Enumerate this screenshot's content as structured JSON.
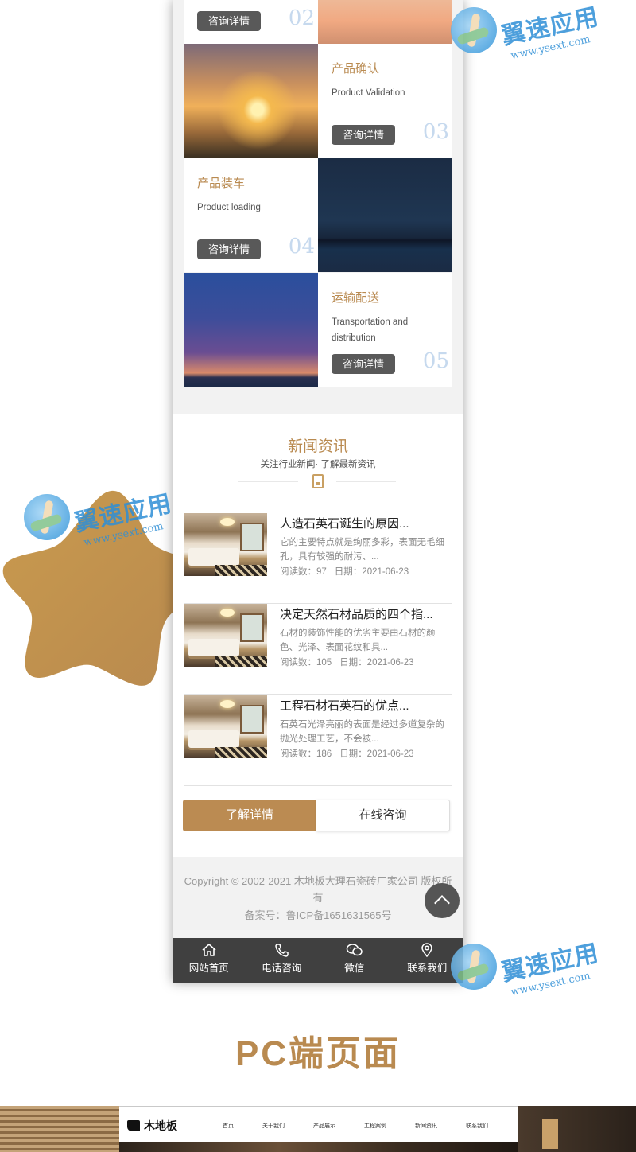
{
  "process": {
    "steps": [
      {
        "title": "",
        "subtitle": "",
        "button": "咨询详情",
        "number": "02"
      },
      {
        "title": "产品确认",
        "subtitle": "Product Validation",
        "button": "咨询详情",
        "number": "03"
      },
      {
        "title": "产品装车",
        "subtitle": "Product loading",
        "button": "咨询详情",
        "number": "04"
      },
      {
        "title": "运输配送",
        "subtitle": "Transportation and distribution",
        "button": "咨询详情",
        "number": "05"
      }
    ]
  },
  "news": {
    "title": "新闻资讯",
    "subtitle": "关注行业新闻· 了解最新资讯",
    "items": [
      {
        "title": "人造石英石诞生的原因...",
        "desc": "它的主要特点就是绚丽多彩，表面无毛细孔，具有较强的耐污、...",
        "reads_label": "阅读数：97",
        "date_label": "日期：2021-06-23"
      },
      {
        "title": "决定天然石材品质的四个指...",
        "desc": "石材的装饰性能的优劣主要由石材的颜色、光泽、表面花纹和具...",
        "reads_label": "阅读数：105",
        "date_label": "日期：2021-06-23"
      },
      {
        "title": "工程石材石英石的优点...",
        "desc": "石英石光泽亮丽的表面是经过多道复杂的抛光处理工艺，不会被...",
        "reads_label": "阅读数：186",
        "date_label": "日期：2021-06-23"
      }
    ],
    "buttons": {
      "primary": "了解详情",
      "secondary": "在线咨询"
    }
  },
  "footer": {
    "copyright": "Copyright © 2002-2021 木地板大理石瓷砖厂家公司 版权所有",
    "icp": "备案号：鲁ICP备1651631565号"
  },
  "tabbar": [
    {
      "label": "网站首页",
      "icon": "home-icon"
    },
    {
      "label": "电话咨询",
      "icon": "phone-icon"
    },
    {
      "label": "微信",
      "icon": "wechat-icon"
    },
    {
      "label": "联系我们",
      "icon": "location-icon"
    }
  ],
  "pc_section": {
    "heading": "PC端页面",
    "logo": "木地板",
    "menu": [
      "首页",
      "关于我们",
      "产品展示",
      "工程案例",
      "新闻资讯",
      "联系我们"
    ]
  },
  "watermark": {
    "name": "翼速应用",
    "url": "www.ysext.com"
  },
  "colors": {
    "accent": "#bb8b52",
    "title": "#b98a50",
    "dark_button": "#595959",
    "tabbar": "#404040",
    "number": "#c6d9ee"
  }
}
